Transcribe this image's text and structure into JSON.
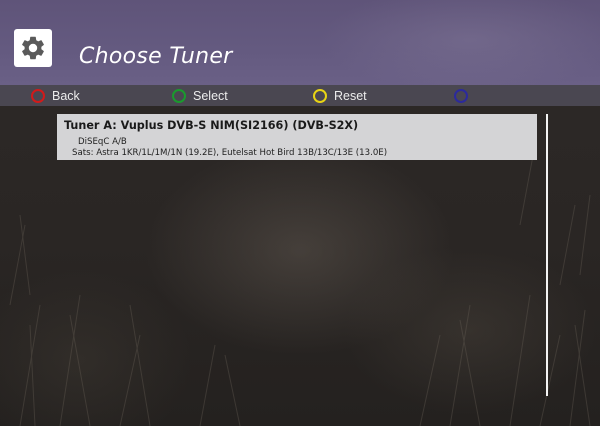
{
  "screen": {
    "title": "Choose Tuner",
    "icon": "gear-icon"
  },
  "buttons": [
    {
      "label": "Back",
      "color": "#d21a1a",
      "key": "red"
    },
    {
      "label": "Select",
      "color": "#1a9a2e",
      "key": "green"
    },
    {
      "label": "Reset",
      "color": "#e8d414",
      "key": "yellow"
    },
    {
      "label": "",
      "color": "#2c2a9c",
      "key": "blue"
    }
  ],
  "tuners": [
    {
      "name": "Tuner A: Vuplus DVB-S NIM(SI2166) (DVB-S2X)",
      "mode": "DiSEqC A/B",
      "sats": "Sats: Astra 1KR/1L/1M/1N (19.2E), Eutelsat Hot Bird 13B/13C/13E (13.0E)",
      "selected": true
    }
  ],
  "colors": {
    "header": "#645a80",
    "button_bar": "#4a4751",
    "selection": "#d4d4d6",
    "background": "#2b2826"
  }
}
